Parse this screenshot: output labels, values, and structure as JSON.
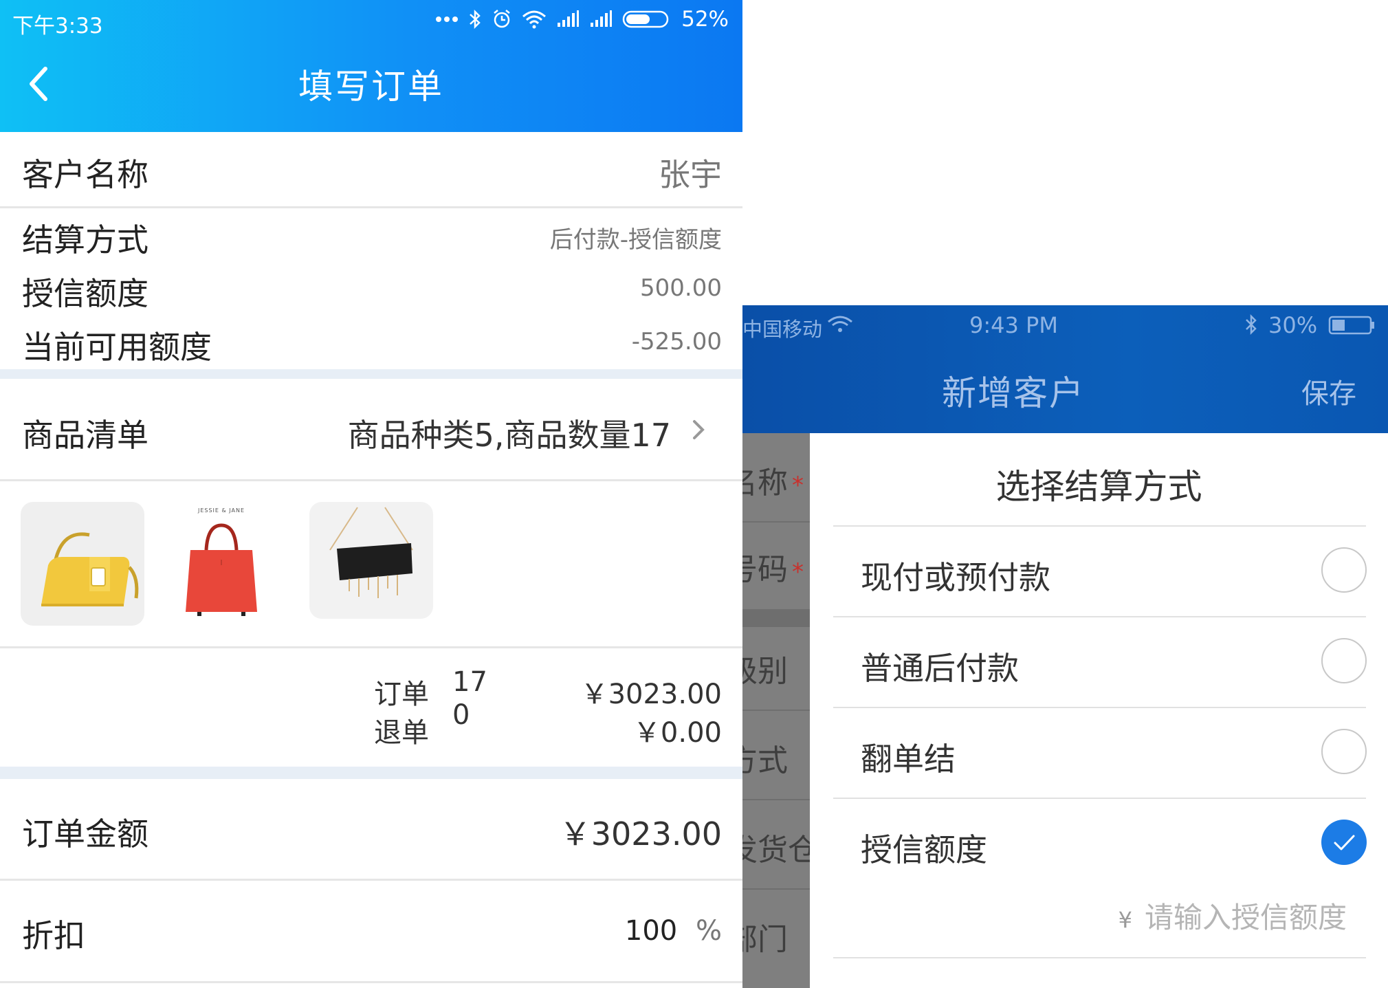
{
  "left": {
    "status_bar": {
      "time": "下午3:33",
      "battery": "52%"
    },
    "header": {
      "title": "填写订单"
    },
    "customer": {
      "label": "客户名称",
      "value": "张宇"
    },
    "settlement": {
      "label": "结算方式",
      "value": "后付款-授信额度"
    },
    "credit_limit": {
      "label": "授信额度",
      "value": "500.00"
    },
    "available_credit": {
      "label": "当前可用额度",
      "value": "-525.00"
    },
    "goods": {
      "label": "商品清单",
      "summary": "商品种类5,商品数量17"
    },
    "products": [
      {
        "name": "yellow-handbag",
        "brand": ""
      },
      {
        "name": "red-tote-bag",
        "brand": "JESSIE & JANE"
      },
      {
        "name": "black-chain-bag",
        "brand": ""
      }
    ],
    "totals": {
      "order_label": "订单",
      "order_qty": "17",
      "order_amount": "￥3023.00",
      "return_label": "退单",
      "return_qty": "0",
      "return_amount": "￥0.00"
    },
    "order_amount": {
      "label": "订单金额",
      "value": "￥3023.00"
    },
    "discount": {
      "label": "折扣",
      "value": "100",
      "unit": "%"
    }
  },
  "right": {
    "status_bar": {
      "carrier": "中国移动",
      "time": "9:43 PM",
      "battery": "30%"
    },
    "header": {
      "title": "新增客户",
      "save": "保存"
    },
    "background_fields": [
      "名称",
      "号码",
      "级别",
      "方式",
      "发货仓",
      "部门"
    ],
    "sheet": {
      "title": "选择结算方式",
      "options": [
        {
          "label": "现付或预付款",
          "selected": false
        },
        {
          "label": "普通后付款",
          "selected": false
        },
        {
          "label": "翻单结",
          "selected": false
        },
        {
          "label": "授信额度",
          "selected": true
        }
      ],
      "credit_currency": "¥",
      "credit_placeholder": "请输入授信额度"
    }
  },
  "colors": {
    "left_header_start": "#0fc0f5",
    "left_header_end": "#0b78f2",
    "right_header": "#0c5fba",
    "radio_selected": "#1c7ce6",
    "required_star": "#e0312c"
  }
}
